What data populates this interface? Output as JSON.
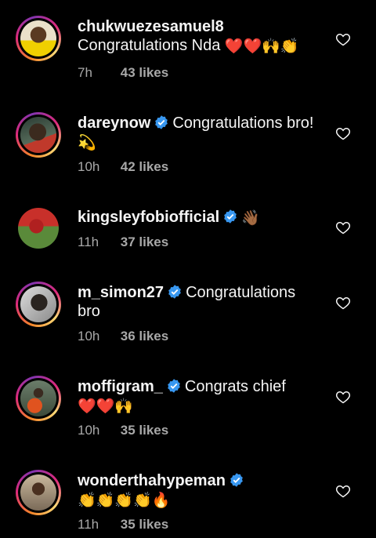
{
  "comments": [
    {
      "username": "chukwuezesamuel8",
      "verified": false,
      "text": "Congratulations Nda",
      "emojis": "❤️❤️🙌👏",
      "time": "7h",
      "likes": "43 likes",
      "story_ring": true
    },
    {
      "username": "dareynow",
      "verified": true,
      "text": "Congratulations bro!",
      "emojis": "💫",
      "time": "10h",
      "likes": "42 likes",
      "story_ring": true
    },
    {
      "username": "kingsleyfobiofficial",
      "verified": true,
      "text": "",
      "emojis": "👋🏾",
      "time": "11h",
      "likes": "37 likes",
      "story_ring": false
    },
    {
      "username": "m_simon27",
      "verified": true,
      "text": "Congratulations bro",
      "emojis": "",
      "time": "10h",
      "likes": "36 likes",
      "story_ring": true
    },
    {
      "username": "moffigram_",
      "verified": true,
      "text": "Congrats chief",
      "emojis": "❤️❤️🙌",
      "time": "10h",
      "likes": "35 likes",
      "story_ring": true
    },
    {
      "username": "wonderthahypeman",
      "verified": true,
      "text": "",
      "emojis": "👏👏👏👏🔥",
      "time": "11h",
      "likes": "35 likes",
      "story_ring": true
    }
  ],
  "icons": {
    "like": "heart-outline-icon",
    "verified": "verified-badge-icon"
  },
  "colors": {
    "background": "#000000",
    "verified_blue": "#3897f0",
    "secondary_text": "#a8a8a8"
  }
}
